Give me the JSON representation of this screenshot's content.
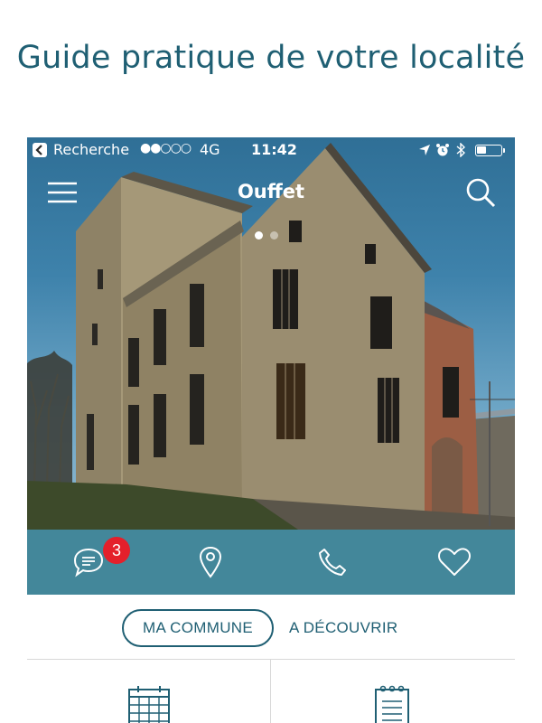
{
  "page": {
    "headline": "Guide pratique de votre localité"
  },
  "status_bar": {
    "back_app": "Recherche",
    "signal": "●●○○○",
    "network": "4G",
    "time": "11:42"
  },
  "nav": {
    "title": "Ouffet",
    "menu_icon": "hamburger-menu-icon",
    "search_icon": "search-icon"
  },
  "carousel": {
    "count": 2,
    "active_index": 0
  },
  "actions": {
    "messages": {
      "icon": "chat-bubble-icon",
      "badge": "3"
    },
    "location": {
      "icon": "map-pin-icon"
    },
    "phone": {
      "icon": "phone-icon"
    },
    "favorites": {
      "icon": "heart-icon"
    }
  },
  "tabs": {
    "active": "MA COMMUNE",
    "other": "A DÉCOUVRIR"
  },
  "tiles": [
    {
      "icon": "calendar-icon"
    },
    {
      "icon": "notepad-icon"
    }
  ],
  "colors": {
    "brand": "#1f5f73",
    "action_bar": "#43879a",
    "badge": "#e4202b",
    "divider": "#d8d8d8"
  }
}
